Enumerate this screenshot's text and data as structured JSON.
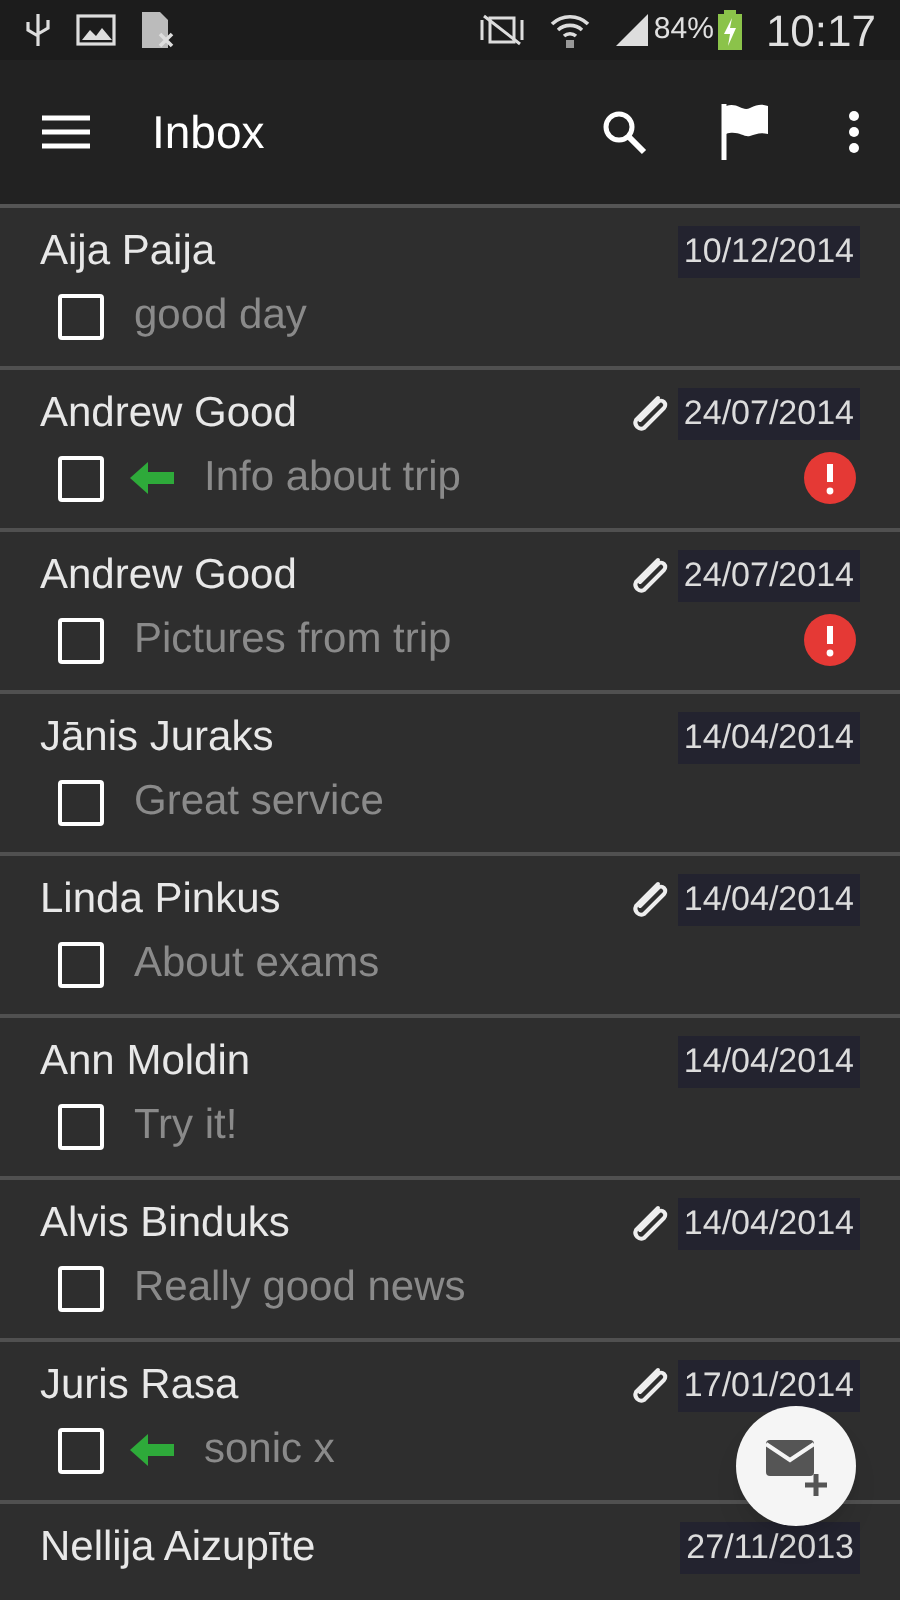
{
  "status_bar": {
    "battery": "84%",
    "time": "10:17"
  },
  "app_bar": {
    "title": "Inbox"
  },
  "messages": [
    {
      "sender": "Aija Paija",
      "date": "10/12/2014",
      "subject": "good day",
      "checked": false,
      "attachment": false,
      "replied": false,
      "important": false
    },
    {
      "sender": "Andrew Good",
      "date": "24/07/2014",
      "subject": "Info about trip",
      "checked": false,
      "attachment": true,
      "replied": true,
      "important": true
    },
    {
      "sender": "Andrew Good",
      "date": "24/07/2014",
      "subject": "Pictures from trip",
      "checked": false,
      "attachment": true,
      "replied": false,
      "important": true
    },
    {
      "sender": "Jānis Juraks",
      "date": "14/04/2014",
      "subject": "Great service",
      "checked": false,
      "attachment": false,
      "replied": false,
      "important": false
    },
    {
      "sender": "Linda Pinkus",
      "date": "14/04/2014",
      "subject": "About exams",
      "checked": false,
      "attachment": true,
      "replied": false,
      "important": false
    },
    {
      "sender": "Ann Moldin",
      "date": "14/04/2014",
      "subject": "Try it!",
      "checked": false,
      "attachment": false,
      "replied": false,
      "important": false
    },
    {
      "sender": "Alvis Binduks",
      "date": "14/04/2014",
      "subject": "Really good news",
      "checked": false,
      "attachment": true,
      "replied": false,
      "important": false
    },
    {
      "sender": "Juris Rasa",
      "date": "17/01/2014",
      "subject": "sonic x",
      "checked": false,
      "attachment": true,
      "replied": true,
      "important": false
    },
    {
      "sender": "Nellija Aizupīte",
      "date": "27/11/2013",
      "attachment": false,
      "replied": false,
      "important": false
    }
  ]
}
